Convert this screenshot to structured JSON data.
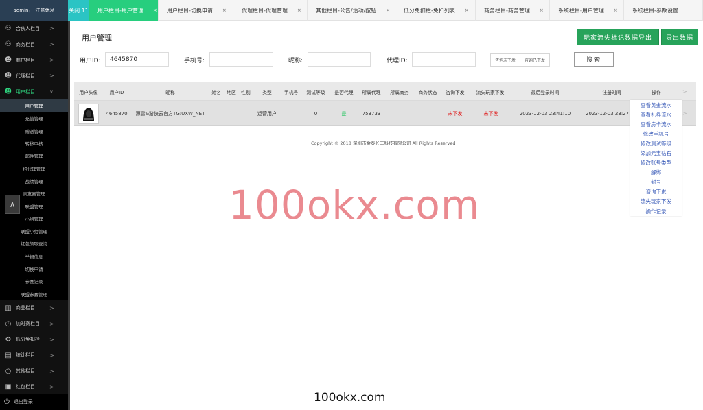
{
  "topbar": {
    "admin_name": "admin，",
    "logout": "注意休息",
    "close_label": "关闭 11",
    "tabs": [
      {
        "label": "用户栏目-用户管理",
        "close": "×",
        "active": true
      },
      {
        "label": "用户栏目-切换申请",
        "close": "×",
        "active": false
      },
      {
        "label": "代理栏目-代理管理",
        "close": "×",
        "active": false
      },
      {
        "label": "其他栏目-公告/活动/按钮",
        "close": "×",
        "active": false
      },
      {
        "label": "低分免扣栏-免扣列表",
        "close": "×",
        "active": false
      },
      {
        "label": "商务栏目-商务管理",
        "close": "×",
        "active": false
      },
      {
        "label": "系统栏目-用户管理",
        "close": "×",
        "active": false
      },
      {
        "label": "系统栏目-参数设置",
        "close": "",
        "active": false
      }
    ]
  },
  "sidebar": {
    "groups_top": [
      {
        "label": "合伙人栏目",
        "icon": "users-icon"
      },
      {
        "label": "商务栏目",
        "icon": "users-icon"
      },
      {
        "label": "商户栏目",
        "icon": "user-icon"
      },
      {
        "label": "代理栏目",
        "icon": "user-icon"
      }
    ],
    "open_group": {
      "label": "用户栏目",
      "icon": "user-icon"
    },
    "sub_items": [
      "用户管理",
      "充值管理",
      "赠送管理",
      "转移审核",
      "邮件管理",
      "招代理管理",
      "战绩管理",
      "亲友圈管理",
      "联盟管理",
      "小组管理",
      "联盟小组管理",
      "红包领取查询",
      "举报信息",
      "切换申请",
      "参赛记录",
      "联盟参赛管理"
    ],
    "groups_bottom": [
      {
        "label": "商品栏目",
        "icon": "bag-icon"
      },
      {
        "label": "加时赛栏目",
        "icon": "clock-icon"
      },
      {
        "label": "低分免扣栏",
        "icon": "gear-icon"
      },
      {
        "label": "统计栏目",
        "icon": "bar-chart-icon"
      },
      {
        "label": "其他栏目",
        "icon": "chat-icon"
      },
      {
        "label": "红包栏目",
        "icon": "gift-icon"
      }
    ],
    "logout_label": "退出登录"
  },
  "main": {
    "title": "用户管理",
    "export_btn1": "玩家流失标记数据导出",
    "export_btn2": "导出数据",
    "filters": {
      "user_id_label": "用户ID:",
      "user_id_value": "4645870",
      "phone_label": "手机号:",
      "nickname_label": "昵称:",
      "agent_id_label": "代理ID:",
      "seg_option1": "咨询未下发",
      "seg_option2": "咨询已下发",
      "search_label": "搜索"
    },
    "columns": [
      "用户头像",
      "用户ID",
      "昵称",
      "姓名",
      "地区",
      "性别",
      "类型",
      "手机号",
      "测试等级",
      "是否代理",
      "所属代理",
      "所属商务",
      "商务状态",
      "咨询下发",
      "流失玩家下发",
      "最后登录时间",
      "注册时间",
      "操作"
    ],
    "row": {
      "user_id": "4645870",
      "nickname": "源雷&游侠云官方TG:UXW_NET",
      "type": "运营用户",
      "test_level": "0",
      "is_agent": "是",
      "agent": "753733",
      "consult": "未下发",
      "lost": "未下发",
      "last_login": "2023-12-03 23:41:10",
      "register": "2023-12-03 23:27"
    },
    "ops": [
      "查看黄金流水",
      "查看礼券流水",
      "查看房卡流水",
      "修改手机号",
      "修改测试等级",
      "添加元宝钻石",
      "修改账号类型",
      "解绑",
      "封号",
      "咨询下发",
      "流失玩家下发",
      "操作记录"
    ],
    "copyright": "Copyright © 2018 深圳市金泰长丰科技有限公司 All Rights Reserved"
  },
  "watermark": {
    "big": "100okx.com",
    "small": "100okx.com"
  },
  "colors": {
    "accent_green": "#27ce7e",
    "sidebar_bg": "#111111",
    "status_red": "#e02020",
    "link_blue": "#3a5bb8"
  }
}
